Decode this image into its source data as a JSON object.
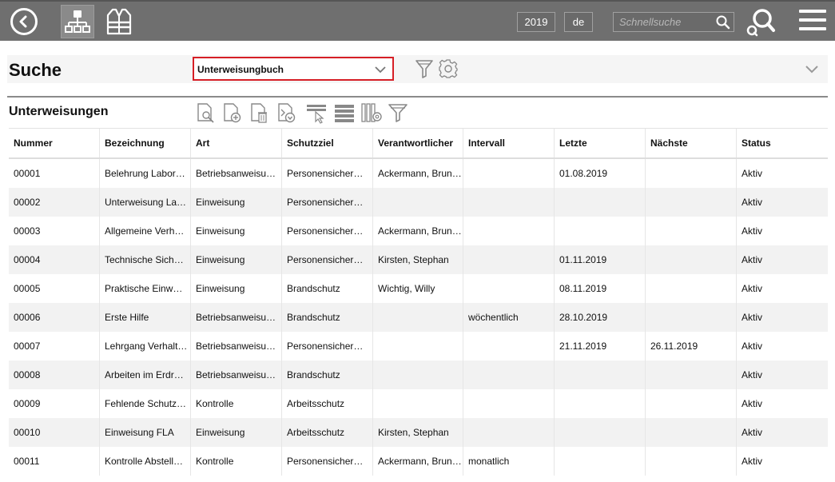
{
  "topbar": {
    "year": "2019",
    "language": "de",
    "quicksearch_placeholder": "Schnellsuche",
    "colors": {
      "bar": "#6f6f6f",
      "icon": "#ffffff"
    }
  },
  "search": {
    "title": "Suche",
    "selected_type": "Unterweisungbuch",
    "accent_color": "#d61f26"
  },
  "list": {
    "title": "Unterweisungen",
    "toolbar_icons": [
      "search-document-icon",
      "add-document-icon",
      "delete-document-icon",
      "export-document-icon",
      "select-row-icon",
      "rows-icon",
      "columns-settings-icon",
      "filter-icon"
    ]
  },
  "table": {
    "columns": [
      "Nummer",
      "Bezeichnung",
      "Art",
      "Schutzziel",
      "Verantwortlicher",
      "Intervall",
      "Letzte",
      "Nächste",
      "Status"
    ],
    "rows": [
      [
        "00001",
        "Belehrung Labor…",
        "Betriebsanweisu…",
        "Personensicher…",
        "Ackermann, Brun…",
        "",
        "01.08.2019",
        "",
        "Aktiv"
      ],
      [
        "00002",
        "Unterweisung La…",
        "Einweisung",
        "Personensicher…",
        "",
        "",
        "",
        "",
        "Aktiv"
      ],
      [
        "00003",
        "Allgemeine Verh…",
        "Einweisung",
        "Personensicher…",
        "Ackermann, Brun…",
        "",
        "",
        "",
        "Aktiv"
      ],
      [
        "00004",
        "Technische Sich…",
        "Einweisung",
        "Personensicher…",
        "Kirsten, Stephan",
        "",
        "01.11.2019",
        "",
        "Aktiv"
      ],
      [
        "00005",
        "Praktische Einw…",
        "Einweisung",
        "Brandschutz",
        "Wichtig, Willy",
        "",
        "08.11.2019",
        "",
        "Aktiv"
      ],
      [
        "00006",
        "Erste Hilfe",
        "Betriebsanweisu…",
        "Brandschutz",
        "",
        "wöchentlich",
        "28.10.2019",
        "",
        "Aktiv"
      ],
      [
        "00007",
        "Lehrgang Verhalt…",
        "Betriebsanweisu…",
        "Personensicher…",
        "",
        "",
        "21.11.2019",
        "26.11.2019",
        "Aktiv"
      ],
      [
        "00008",
        "Arbeiten im Erdr…",
        "Betriebsanweisu…",
        "Brandschutz",
        "",
        "",
        "",
        "",
        "Aktiv"
      ],
      [
        "00009",
        "Fehlende Schutz…",
        "Kontrolle",
        "Arbeitsschutz",
        "",
        "",
        "",
        "",
        "Aktiv"
      ],
      [
        "00010",
        "Einweisung FLA",
        "Einweisung",
        "Arbeitsschutz",
        "Kirsten, Stephan",
        "",
        "",
        "",
        "Aktiv"
      ],
      [
        "00011",
        "Kontrolle Abstell…",
        "Kontrolle",
        "Personensicher…",
        "Ackermann, Brun…",
        "monatlich",
        "",
        "",
        "Aktiv"
      ]
    ]
  }
}
